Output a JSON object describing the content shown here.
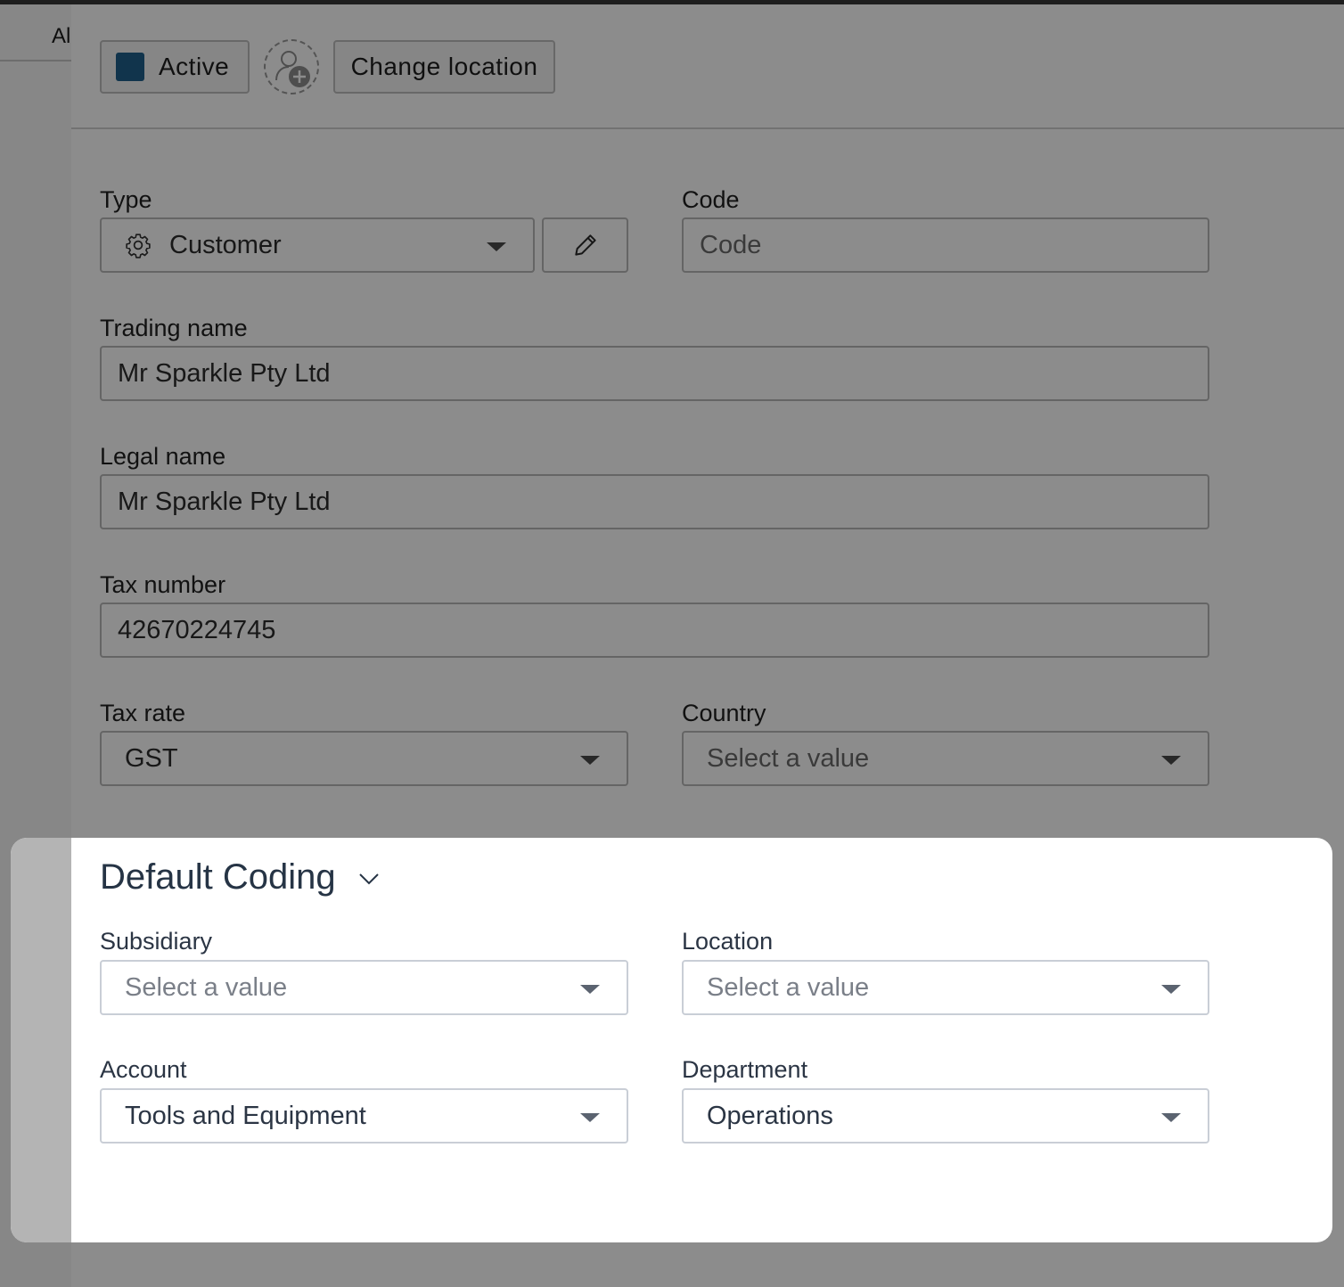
{
  "background": {
    "tab_text": "Al"
  },
  "toolbar": {
    "status_label": "Active",
    "status_color": "#1f5f8b",
    "change_location_label": "Change location"
  },
  "form": {
    "type": {
      "label": "Type",
      "value": "Customer"
    },
    "code": {
      "label": "Code",
      "placeholder": "Code"
    },
    "trading_name": {
      "label": "Trading name",
      "value": "Mr Sparkle Pty Ltd"
    },
    "legal_name": {
      "label": "Legal name",
      "value": "Mr Sparkle Pty Ltd"
    },
    "tax_number": {
      "label": "Tax number",
      "value": "42670224745"
    },
    "tax_rate": {
      "label": "Tax rate",
      "value": "GST"
    },
    "country": {
      "label": "Country",
      "placeholder": "Select a value"
    }
  },
  "default_coding": {
    "title": "Default Coding",
    "subsidiary": {
      "label": "Subsidiary",
      "placeholder": "Select a value"
    },
    "location": {
      "label": "Location",
      "placeholder": "Select a value"
    },
    "account": {
      "label": "Account",
      "value": "Tools and Equipment"
    },
    "department": {
      "label": "Department",
      "value": "Operations"
    }
  }
}
